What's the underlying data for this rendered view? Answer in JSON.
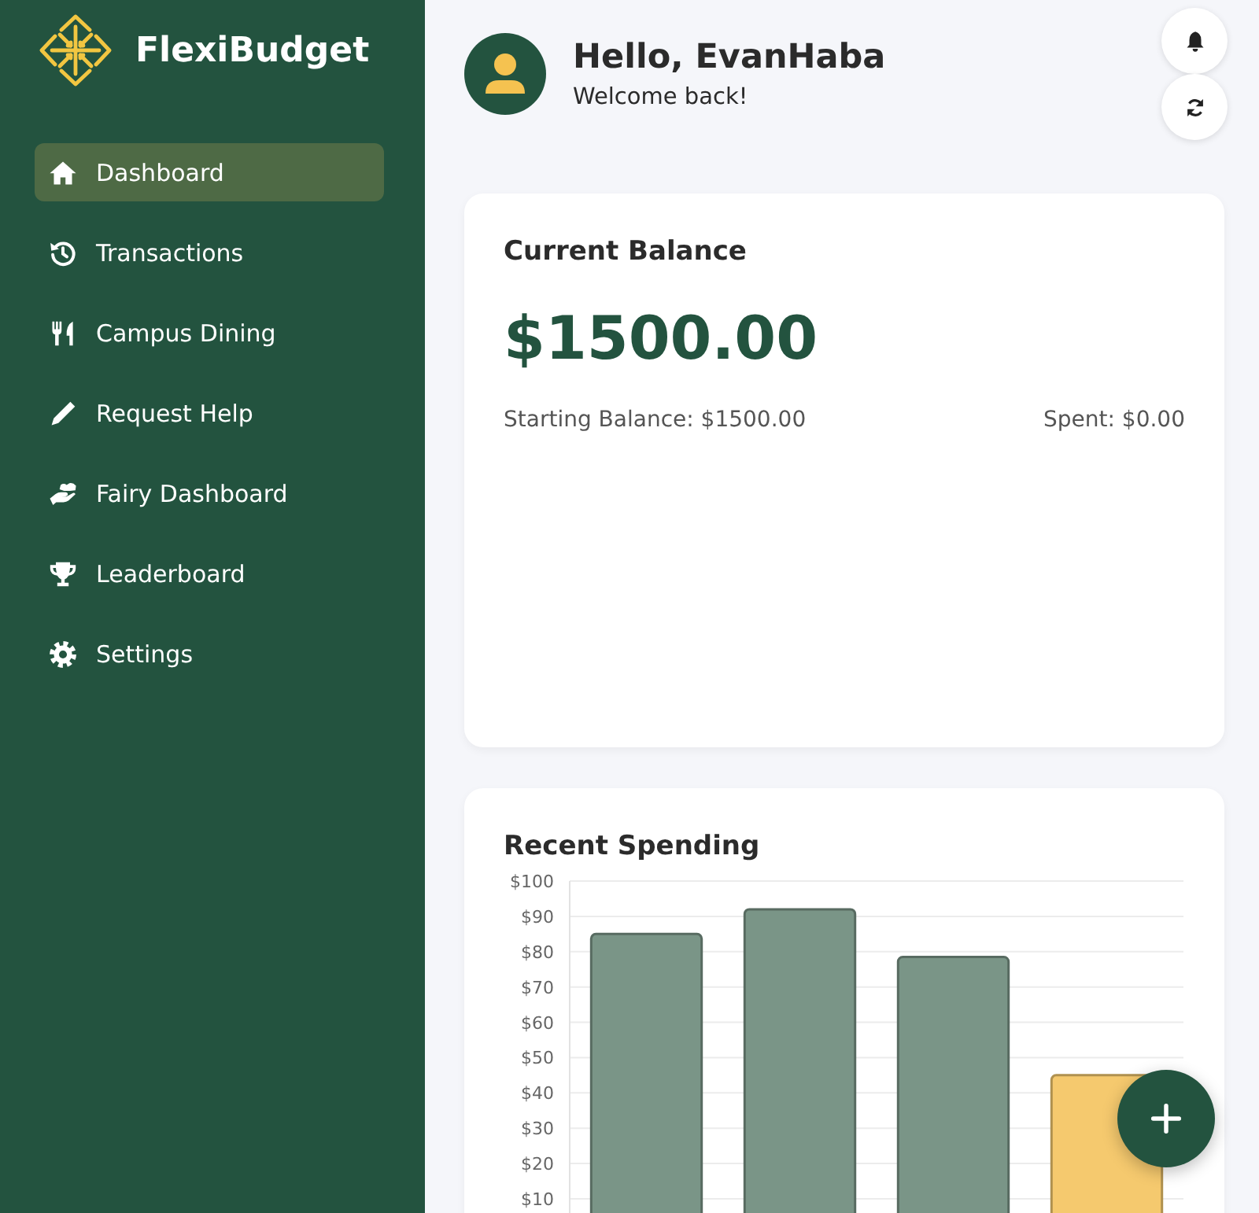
{
  "sidebar": {
    "brand": "FlexiBudget",
    "items": [
      {
        "label": "Dashboard",
        "selected": true
      },
      {
        "label": "Transactions",
        "selected": false
      },
      {
        "label": "Campus Dining",
        "selected": false
      },
      {
        "label": "Request Help",
        "selected": false
      },
      {
        "label": "Fairy Dashboard",
        "selected": false
      },
      {
        "label": "Leaderboard",
        "selected": false
      },
      {
        "label": "Settings",
        "selected": false
      }
    ]
  },
  "header": {
    "greeting": "Hello, EvanHaba",
    "subtitle": "Welcome back!"
  },
  "balance_card": {
    "title": "Current Balance",
    "amount": "$1500.00",
    "starting_balance": "Starting Balance: $1500.00",
    "spent": "Spent: $0.00"
  },
  "spending_card": {
    "title": "Recent Spending",
    "chart_data": {
      "type": "bar",
      "stacked": true,
      "grid": true,
      "ylim": [
        0,
        100
      ],
      "yticks": [
        {
          "value": 10,
          "label": "$10"
        },
        {
          "value": 20,
          "label": "$20"
        },
        {
          "value": 30,
          "label": "$30"
        },
        {
          "value": 40,
          "label": "$40"
        },
        {
          "value": 50,
          "label": "$50"
        },
        {
          "value": 60,
          "label": "$60"
        },
        {
          "value": 70,
          "label": "$70"
        },
        {
          "value": 80,
          "label": "$80"
        },
        {
          "value": 90,
          "label": "$90"
        },
        {
          "value": 100,
          "label": "$100"
        }
      ],
      "series": [
        {
          "color": "#7a9587",
          "values": [
            85,
            92,
            78.5,
            null
          ]
        },
        {
          "color": "#f5c96e",
          "values": [
            null,
            null,
            null,
            45
          ]
        }
      ]
    }
  }
}
